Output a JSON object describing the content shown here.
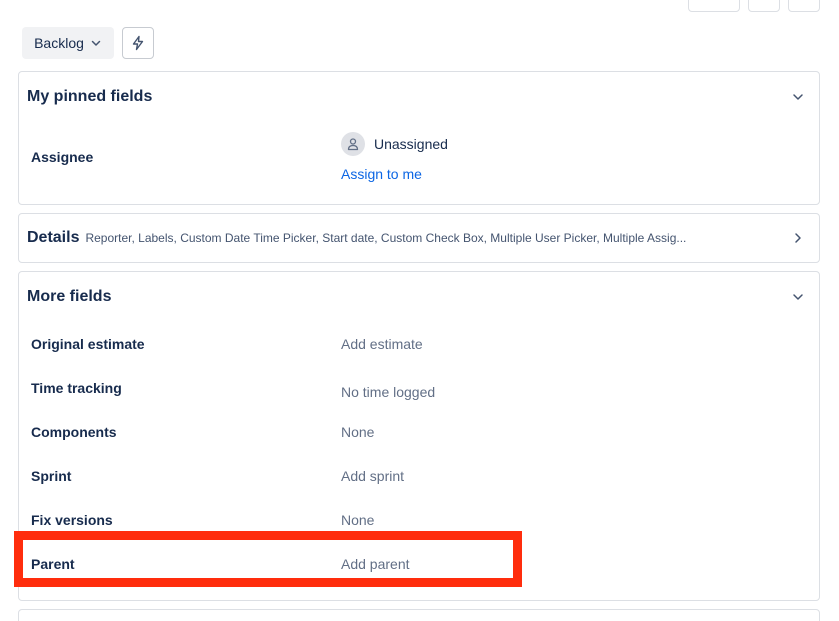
{
  "toolbar": {
    "status_label": "Backlog",
    "status_icon": "chevron-down-icon",
    "automation_icon": "lightning-bolt-icon"
  },
  "pinned": {
    "title": "My pinned fields",
    "assignee_label": "Assignee",
    "assignee_value": "Unassigned",
    "assign_to_me": "Assign to me"
  },
  "details": {
    "title": "Details",
    "summary": "Reporter, Labels, Custom Date Time Picker, Start date, Custom Check Box, Multiple User Picker, Multiple Assig..."
  },
  "more_fields": {
    "title": "More fields",
    "rows": [
      {
        "label": "Original estimate",
        "value": "Add estimate"
      },
      {
        "label": "Time tracking",
        "value": "No time logged"
      },
      {
        "label": "Components",
        "value": "None"
      },
      {
        "label": "Sprint",
        "value": "Add sprint"
      },
      {
        "label": "Fix versions",
        "value": "None"
      },
      {
        "label": "Parent",
        "value": "Add parent"
      }
    ]
  },
  "colors": {
    "link": "#0c66e4",
    "highlight": "#ff2d0d"
  }
}
